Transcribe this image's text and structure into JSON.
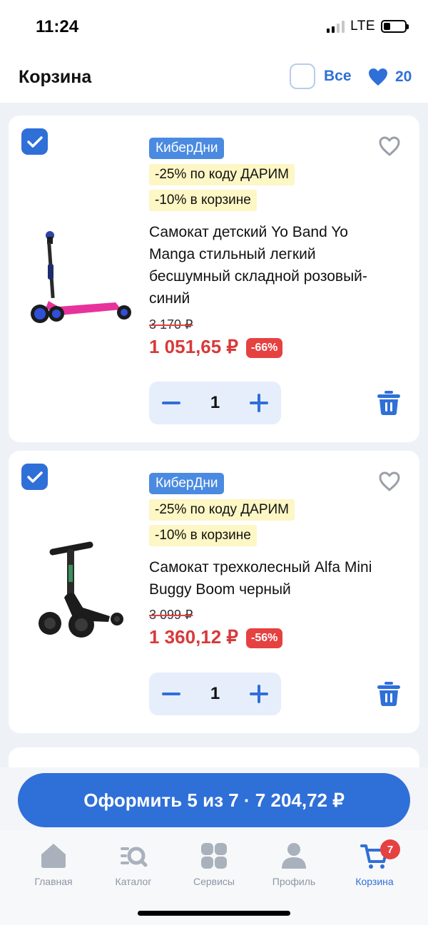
{
  "status": {
    "time": "11:24",
    "network": "LTE"
  },
  "header": {
    "title": "Корзина",
    "select_all_label": "Все",
    "favorites_count": "20"
  },
  "items": [
    {
      "badge": "КиберДни",
      "promo_code": "-25% по коду ДАРИМ",
      "promo_cart": "-10% в корзине",
      "title": "Самокат детский Yo Band Yo Manga стильный легкий бесшумный складной розовый-синий",
      "old_price": "3 170 ₽",
      "price": "1 051,65 ₽",
      "discount": "-66%",
      "quantity": "1",
      "selected": true
    },
    {
      "badge": "КиберДни",
      "promo_code": "-25% по коду ДАРИМ",
      "promo_cart": "-10% в корзине",
      "title": "Самокат трехколесный Alfa Mini Buggy Boom черный",
      "old_price": "3 099 ₽",
      "price": "1 360,12 ₽",
      "discount": "-56%",
      "quantity": "1",
      "selected": true
    }
  ],
  "checkout": {
    "label": "Оформить 5 из 7 · 7 204,72 ₽"
  },
  "tabbar": {
    "tabs": [
      {
        "label": "Главная",
        "icon": "home-icon"
      },
      {
        "label": "Каталог",
        "icon": "catalog-search-icon"
      },
      {
        "label": "Сервисы",
        "icon": "services-grid-icon"
      },
      {
        "label": "Профиль",
        "icon": "profile-icon"
      },
      {
        "label": "Корзина",
        "icon": "cart-icon",
        "badge": "7",
        "active": true
      }
    ]
  },
  "colors": {
    "accent": "#2f6fd8",
    "sale": "#e64141",
    "promo_bg": "#fdf6c5",
    "badge_bg": "#4a8ae0"
  }
}
